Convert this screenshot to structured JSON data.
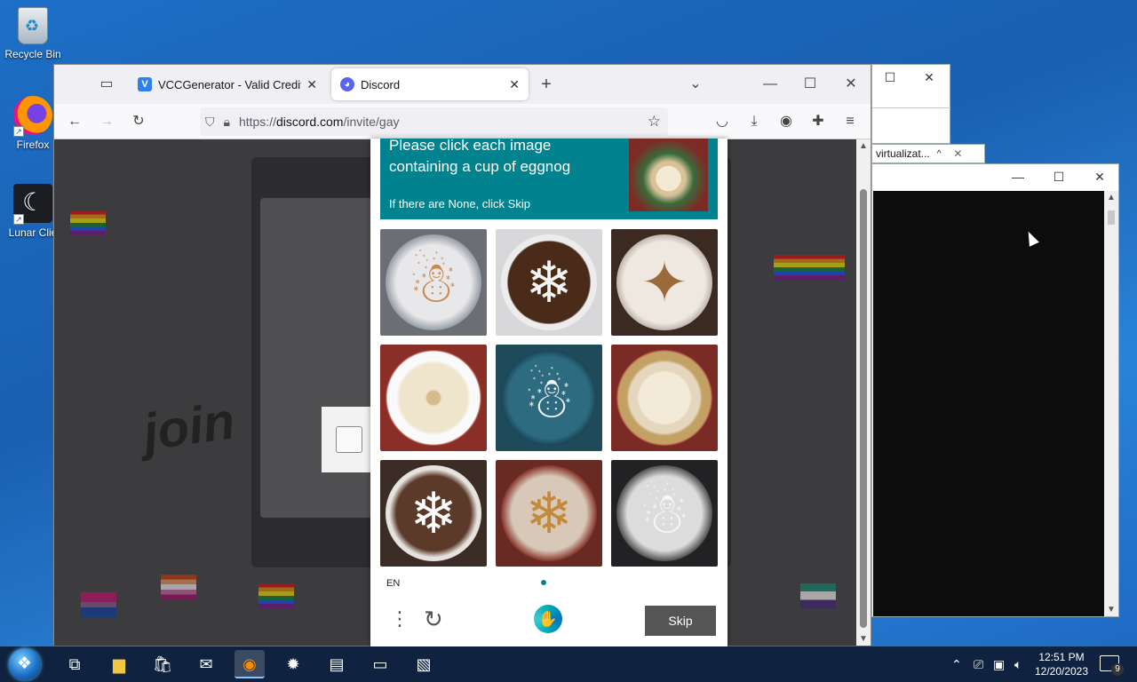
{
  "desktop": {
    "icons": [
      {
        "label": "Recycle Bin",
        "icon": "recycle-bin-icon"
      },
      {
        "label": "Firefox",
        "icon": "firefox-icon"
      },
      {
        "label": "Lunar Clie",
        "icon": "lunar-client-icon"
      }
    ]
  },
  "browser": {
    "tabs": [
      {
        "title": "VCCGenerator - Valid Credit Car",
        "favicon": "V",
        "favicon_color": "#2f80ed",
        "active": false
      },
      {
        "title": "Discord",
        "favicon": "d",
        "favicon_color": "#5865f2",
        "active": true
      }
    ],
    "url_prefix": "https://",
    "url_host": "discord.com",
    "url_path": "/invite/gay"
  },
  "captcha": {
    "prompt": "Please click each image containing a cup of eggnog",
    "hint": "If there are None, click Skip",
    "language": "EN",
    "skip_label": "Skip",
    "accent_color": "#00838f",
    "tiles": [
      {
        "subject": "snowman cookie"
      },
      {
        "subject": "snowflake cookie"
      },
      {
        "subject": "star cookie"
      },
      {
        "subject": "cup of eggnog"
      },
      {
        "subject": "snowman cookie"
      },
      {
        "subject": "cup of eggnog"
      },
      {
        "subject": "snowflake cookie"
      },
      {
        "subject": "snowflake cookie"
      },
      {
        "subject": "snowman cookie"
      }
    ]
  },
  "background_window": {
    "tab_label": "virtualizat..."
  },
  "taskbar": {
    "time": "12:51 PM",
    "date": "12/20/2023",
    "notification_count": "9"
  }
}
